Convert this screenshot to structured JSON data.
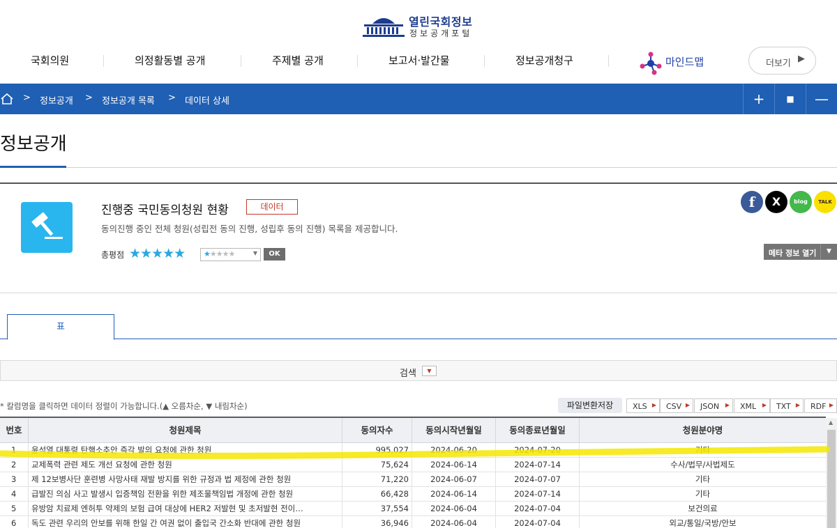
{
  "logo": {
    "title": "열린국회정보",
    "subtitle": "정보공개포털"
  },
  "nav": {
    "items": [
      "국회의원",
      "의정활동별 공개",
      "주제별 공개",
      "보고서·발간물",
      "정보공개청구"
    ],
    "mindmap": "마인드맵",
    "more": "더보기"
  },
  "breadcrumb": {
    "items": [
      "정보공개",
      "정보공개 목록",
      "데이터 상세"
    ],
    "controls": [
      "+",
      "■",
      "—"
    ]
  },
  "page": {
    "title": "정보공개"
  },
  "dataset": {
    "title": "진행중 국민동의청원 현황",
    "badge": "데이터",
    "description": "동의진행 중인 전체 청원(성립전 동의 진행, 성립후 동의 진행) 목록을 제공합니다.",
    "rating_label": "총평점",
    "rating_stars": "★★★★★",
    "rating_value": 5,
    "select_filled": "★",
    "select_empty": "★★★★",
    "ok": "OK",
    "meta_button": "메타 정보 열기"
  },
  "social": {
    "facebook": "f",
    "x": "X",
    "blog": "blog",
    "kakao": "TALK"
  },
  "tabs": {
    "active": "표"
  },
  "search": {
    "label": "검색"
  },
  "sort_hint": "* 칼럼명을 클릭하면 데이터 정렬이 가능합니다.(▲ 오름차순, ▼ 내림차순)",
  "export": {
    "convert_label": "파일변환저장",
    "formats": [
      "XLS",
      "CSV",
      "JSON",
      "XML",
      "TXT",
      "RDF"
    ]
  },
  "table": {
    "columns": [
      "번호",
      "청원제목",
      "동의자수",
      "동의시작년월일",
      "동의종료년월일",
      "청원분야명"
    ],
    "rows": [
      [
        "1",
        "윤석열 대통령 탄핵소추안 즉각 발의 요청에 관한 청원",
        "995,027",
        "2024-06-20",
        "2024-07-20",
        "기타"
      ],
      [
        "2",
        "교제폭력 관련 제도 개선 요청에 관한 청원",
        "75,624",
        "2024-06-14",
        "2024-07-14",
        "수사/법무/사법제도"
      ],
      [
        "3",
        "제 12보병사단 훈련병 사망사태 재발 방지를 위한 규정과 법 제정에 관한 청원",
        "71,220",
        "2024-06-07",
        "2024-07-07",
        "기타"
      ],
      [
        "4",
        "급발진 의심 사고 발생시 입증책임 전환을 위한 제조물책임법 개정에 관한 청원",
        "66,428",
        "2024-06-14",
        "2024-07-14",
        "기타"
      ],
      [
        "5",
        "유방암 치료제 엔허투 약제의 보험 급여 대상에 HER2 저발현 및 초저발현 전이…",
        "37,554",
        "2024-06-04",
        "2024-07-04",
        "보건의료"
      ],
      [
        "6",
        "독도 관련 우리의 안보를 위해 한일 간 여권 없이 출입국 간소화 반대에 관한 청원",
        "36,946",
        "2024-06-04",
        "2024-07-04",
        "외교/통일/국방/안보"
      ]
    ]
  },
  "colors": {
    "brand_blue": "#1f5fb4",
    "highlight": "#f5e800",
    "accent_cyan": "#29b6ee"
  }
}
